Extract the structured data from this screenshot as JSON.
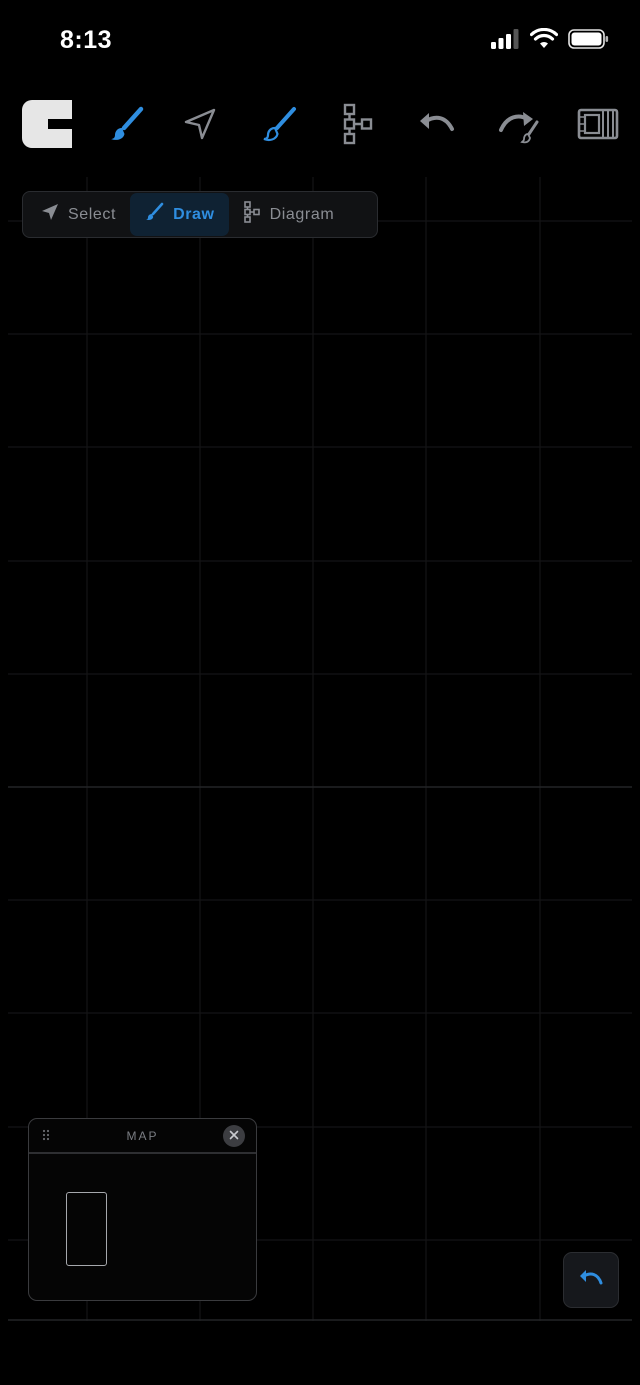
{
  "status_bar": {
    "time": "8:13"
  },
  "toolbar": {
    "items": [
      "logo-icon",
      "brush-icon",
      "navigate-icon",
      "draw-icon",
      "diagram-icon",
      "undo-icon",
      "redo-icon",
      "frames-icon"
    ]
  },
  "mode_bar": {
    "select_label": "Select",
    "draw_label": "Draw",
    "diagram_label": "Diagram",
    "active": "Draw"
  },
  "minimap": {
    "title": "MAP"
  },
  "colors": {
    "accent": "#2f8ee0",
    "background": "#000000",
    "grid_minor": "#141416",
    "grid_major": "#222326",
    "icon_inactive": "#8a8d93"
  }
}
